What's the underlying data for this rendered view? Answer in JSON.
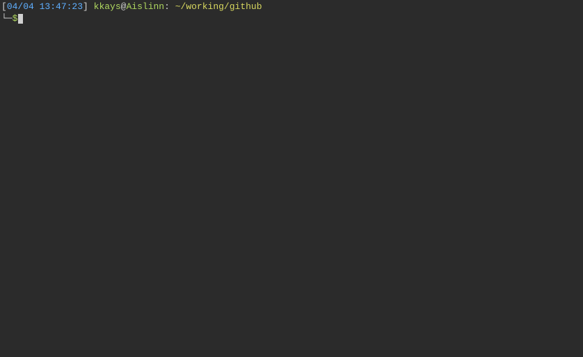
{
  "prompt": {
    "bracket_open": "[",
    "datetime": "04/04 13:47:23",
    "bracket_close": "]",
    "user": "kkays",
    "at": "@",
    "host": "Aislinn",
    "colon": ":",
    "path": "~/working/github",
    "corner": "└─",
    "dollar": "$"
  }
}
